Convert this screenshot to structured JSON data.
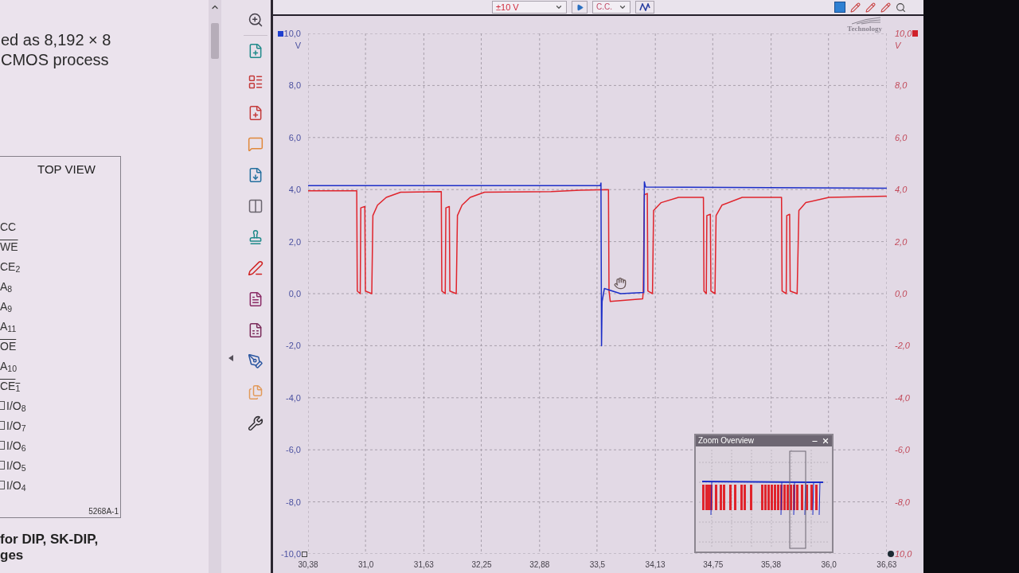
{
  "pdf": {
    "text_lines": [
      "ed as 8,192 × 8",
      "CMOS process"
    ],
    "figure": {
      "title": "TOP VIEW",
      "pins": [
        {
          "label": "CC",
          "overline": false,
          "kind": "label"
        },
        {
          "label": "WE",
          "overline": true,
          "kind": "label"
        },
        {
          "label": "CE$_{2}$",
          "overline": false,
          "kind": "label"
        },
        {
          "label": "A$_{8}$",
          "overline": false,
          "kind": "label"
        },
        {
          "label": "A$_{9}$",
          "overline": false,
          "kind": "label"
        },
        {
          "label": "A$_{11}$",
          "overline": false,
          "kind": "label"
        },
        {
          "label": "OE",
          "overline": true,
          "kind": "label"
        },
        {
          "label": "A$_{10}$",
          "overline": false,
          "kind": "label"
        },
        {
          "label": "CE$_{1}$",
          "overline": true,
          "kind": "label"
        },
        {
          "label": "I/O$_{8}$",
          "overline": false,
          "kind": "boxed"
        },
        {
          "label": "I/O$_{7}$",
          "overline": false,
          "kind": "boxed"
        },
        {
          "label": "I/O$_{6}$",
          "overline": false,
          "kind": "boxed"
        },
        {
          "label": "I/O$_{5}$",
          "overline": false,
          "kind": "boxed"
        },
        {
          "label": "I/O$_{4}$",
          "overline": false,
          "kind": "boxed"
        }
      ],
      "figure_id": "5268A-1"
    },
    "caption_lines": [
      "for DIP, SK-DIP,",
      "ges"
    ]
  },
  "scope": {
    "toolbar": {
      "range": "±10 V",
      "coupling": "C.C."
    },
    "logo_text": "Technology",
    "chart_data": [
      {
        "type": "line",
        "ylabel": "V",
        "y2label": "V",
        "xlim": [
          30.38,
          36.63
        ],
        "ylim": [
          -10,
          10
        ],
        "y2lim": [
          -10,
          10
        ],
        "grid": true,
        "xticks": [
          {
            "value": 30.38,
            "label": "30,38"
          },
          {
            "value": 31.0,
            "label": "31,0"
          },
          {
            "value": 31.63,
            "label": "31,63"
          },
          {
            "value": 32.25,
            "label": "32,25"
          },
          {
            "value": 32.88,
            "label": "32,88"
          },
          {
            "value": 33.5,
            "label": "33,5"
          },
          {
            "value": 34.13,
            "label": "34,13"
          },
          {
            "value": 34.75,
            "label": "34,75"
          },
          {
            "value": 35.38,
            "label": "35,38"
          },
          {
            "value": 36.0,
            "label": "36,0"
          },
          {
            "value": 36.63,
            "label": "36,63"
          }
        ],
        "yticks": [
          {
            "value": 10,
            "label": "10,0"
          },
          {
            "value": 8,
            "label": "8,0"
          },
          {
            "value": 6,
            "label": "6,0"
          },
          {
            "value": 4,
            "label": "4,0"
          },
          {
            "value": 2,
            "label": "2,0"
          },
          {
            "value": 0,
            "label": "0,0"
          },
          {
            "value": -2,
            "label": "-2,0"
          },
          {
            "value": -4,
            "label": "-4,0"
          },
          {
            "value": -6,
            "label": "-6,0"
          },
          {
            "value": -8,
            "label": "-8,0"
          },
          {
            "value": -10,
            "label": "-10,0"
          }
        ],
        "y2ticks": [
          {
            "value": 10,
            "label": "10,0"
          },
          {
            "value": 8,
            "label": "8,0"
          },
          {
            "value": 6,
            "label": "6,0"
          },
          {
            "value": 4,
            "label": "4,0"
          },
          {
            "value": 2,
            "label": "2,0"
          },
          {
            "value": 0,
            "label": "0,0"
          },
          {
            "value": -2,
            "label": "-2,0"
          },
          {
            "value": -4,
            "label": "-4,0"
          },
          {
            "value": -6,
            "label": "-6,0"
          },
          {
            "value": -8,
            "label": "-8,0"
          },
          {
            "value": -10,
            "label": "10,0"
          }
        ],
        "series": [
          {
            "color": "#e0242c",
            "x": [
              30.38,
              30.905,
              30.911,
              30.943,
              30.949,
              30.993,
              30.999,
              31.068,
              31.08,
              31.13,
              31.224,
              31.38,
              31.818,
              31.824,
              31.861,
              31.868,
              31.905,
              31.911,
              31.98,
              31.993,
              32.043,
              32.13,
              32.286,
              33.005,
              33.318,
              33.624,
              33.63,
              33.643,
              33.993,
              33.999,
              34.011,
              34.043,
              34.049,
              34.099,
              34.111,
              34.193,
              34.38,
              34.649,
              34.655,
              34.68,
              34.686,
              34.724,
              34.73,
              34.774,
              34.786,
              34.849,
              35.068,
              35.493,
              35.499,
              35.543,
              35.549,
              35.58,
              35.586,
              35.661,
              35.68,
              35.755,
              36.005,
              36.63
            ],
            "values": [
              3.95,
              3.95,
              0.1,
              0,
              3.3,
              3.35,
              0.1,
              0,
              3,
              3.4,
              3.7,
              3.9,
              3.92,
              0.1,
              0,
              3.3,
              3.35,
              0.1,
              0,
              3,
              3.4,
              3.7,
              3.9,
              3.92,
              3.98,
              4,
              0.1,
              -0.3,
              -0.2,
              0.1,
              3.8,
              3.85,
              0.1,
              0,
              3.2,
              3.5,
              3.7,
              3.7,
              0.1,
              0,
              3,
              3.05,
              0.1,
              0,
              3,
              3.4,
              3.7,
              3.7,
              0.1,
              0,
              3,
              3.05,
              0.1,
              0,
              3.2,
              3.5,
              3.7,
              3.75
            ]
          },
          {
            "color": "#1d2fc8",
            "x": [
              30.38,
              33.536,
              33.543,
              33.549,
              33.555,
              33.58,
              33.755,
              34.005,
              34.011,
              34.024,
              36.63
            ],
            "values": [
              4.15,
              4.15,
              4.25,
              -2.0,
              -0.3,
              0.2,
              0,
              0.05,
              4.3,
              4.1,
              4.05
            ]
          }
        ]
      }
    ],
    "zoom_overview": {
      "title": "Zoom Overview"
    }
  }
}
